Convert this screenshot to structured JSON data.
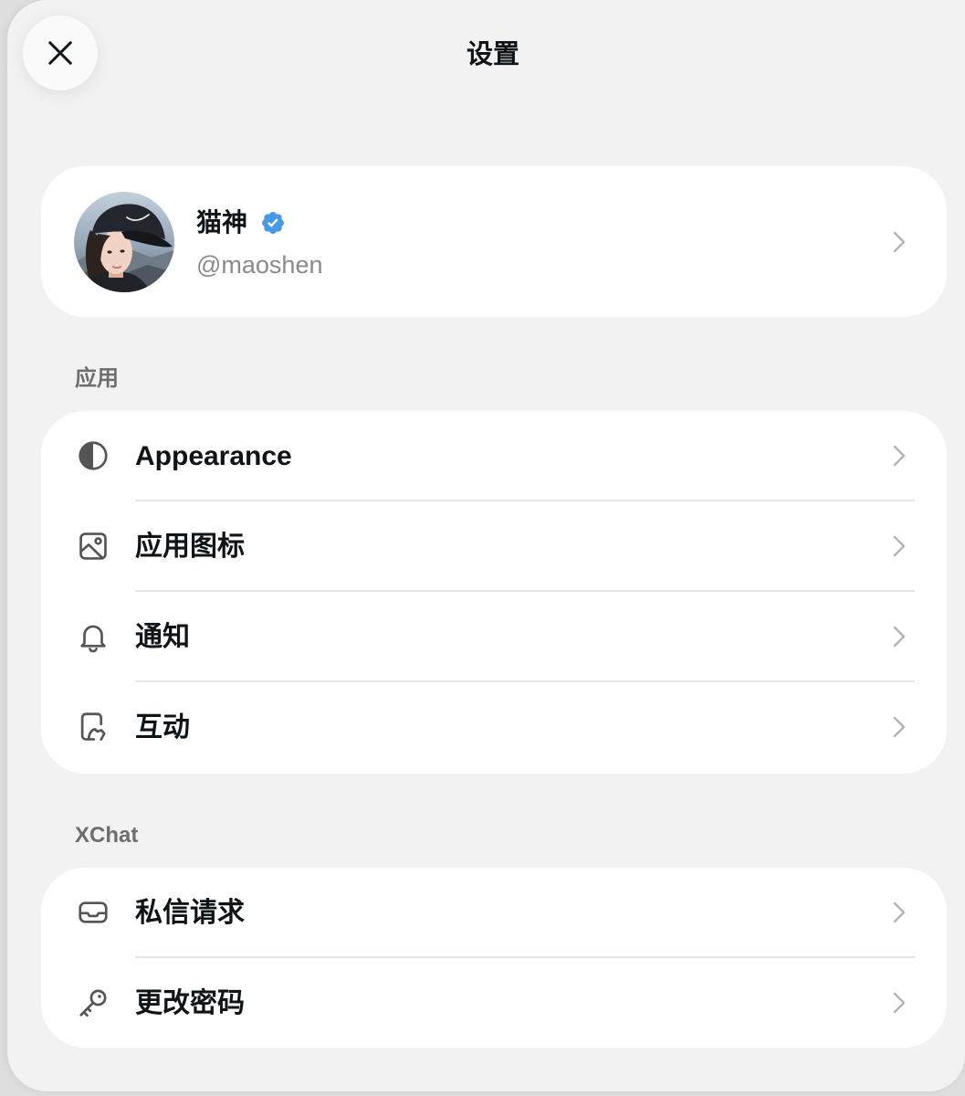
{
  "header": {
    "title": "设置",
    "close_icon": "close-icon"
  },
  "profile": {
    "name": "猫神",
    "handle": "@maoshen",
    "verified": true,
    "verified_icon": "verified-badge-icon",
    "chevron_icon": "chevron-right-icon"
  },
  "sections": [
    {
      "label": "应用",
      "items": [
        {
          "label": "Appearance",
          "icon": "contrast-icon"
        },
        {
          "label": "应用图标",
          "icon": "image-icon"
        },
        {
          "label": "通知",
          "icon": "bell-icon"
        },
        {
          "label": "互动",
          "icon": "interaction-icon"
        }
      ]
    },
    {
      "label": "XChat",
      "items": [
        {
          "label": "私信请求",
          "icon": "inbox-icon"
        },
        {
          "label": "更改密码",
          "icon": "key-icon"
        }
      ]
    }
  ],
  "colors": {
    "sheet_background": "#f2f2f2",
    "card_background": "#ffffff",
    "text_primary": "#0f1419",
    "text_secondary": "#8a8a8a",
    "section_label": "#6e6e6e",
    "verified_blue": "#4599e6",
    "icon": "#555555",
    "chevron": "#b3b3b3"
  }
}
